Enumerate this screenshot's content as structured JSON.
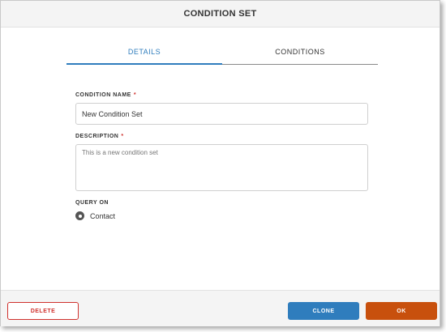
{
  "dialog": {
    "title": "CONDITION SET"
  },
  "tabs": [
    {
      "label": "DETAILS",
      "active": true
    },
    {
      "label": "CONDITIONS",
      "active": false
    }
  ],
  "form": {
    "name_label": "CONDITION NAME",
    "name_required": "*",
    "name_value": "New Condition Set",
    "description_label": "DESCRIPTION",
    "description_required": "*",
    "description_value": "This is a new condition set",
    "query_on_label": "QUERY ON",
    "query_on_option": "Contact"
  },
  "footer": {
    "delete_label": "DELETE",
    "clone_label": "CLONE",
    "ok_label": "OK"
  },
  "colors": {
    "accent_blue": "#2f7dbd",
    "ok_orange": "#c8500d",
    "danger_red": "#d0312d"
  }
}
